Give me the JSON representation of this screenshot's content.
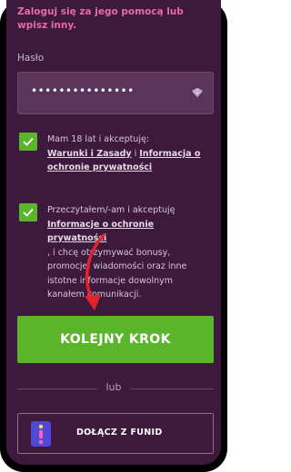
{
  "header_note": "Zaloguj się za jego pomocą lub wpisz inny.",
  "password": {
    "label": "Hasło",
    "value": "•••••••••••••••"
  },
  "consent_age": {
    "prefix": "Mam 18 lat i akceptuję:",
    "link1": "Warunki i Zasady",
    "connector": " i ",
    "link2": "Informacja o ochronie prywatności"
  },
  "consent_marketing": {
    "prefix": "Przeczytałem/-am i akceptuję",
    "link": "Informacje o ochronie prywatności",
    "line1": ", i chcę otrzymywać bonusy,",
    "line2": "promocje, wiadomości oraz inne",
    "line3": "istotne informacje dowolnym",
    "line4": "kanałem komunikacji."
  },
  "primary_button": "KOLEJNY KROK",
  "divider": "lub",
  "alt_button": "DOŁĄCZ Z FUNID",
  "colors": {
    "background": "#3d1a3d",
    "accent_green": "#5bb52a",
    "note_pink": "#e86aa6",
    "arrow_red": "#e0242b"
  }
}
